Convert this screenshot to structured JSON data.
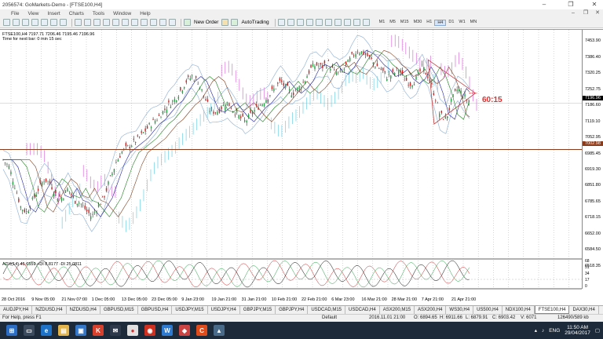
{
  "window": {
    "title": "2056574: GoMarkets-Demo - [FTSE100,H4]"
  },
  "menu": [
    "File",
    "View",
    "Insert",
    "Charts",
    "Tools",
    "Window",
    "Help"
  ],
  "toolbar": {
    "new_order": "New Order",
    "autotrading": "AutoTrading"
  },
  "timeframes": [
    "M1",
    "M5",
    "M15",
    "M30",
    "H1",
    "H4",
    "D1",
    "W1",
    "MN"
  ],
  "active_timeframe": "H4",
  "chart": {
    "info_line1": "FTSE100,H4  7197.71 7206.46 7195.46 7196.96",
    "info_line2": "Time for next bar: 0 min 15 sec",
    "osc_label": "ADX(14) 45.6559 +DI 8.8177 -DI 25.0811",
    "annotation": "60:15",
    "current_price": "7196.96",
    "horizontal_line_price": "7002.98",
    "price_ticks": [
      "7453.90",
      "7386.40",
      "7320.25",
      "7252.75",
      "7186.60",
      "7119.10",
      "7052.95",
      "6985.45",
      "6919.30",
      "6851.80",
      "6785.65",
      "6718.15",
      "6652.00",
      "6584.50",
      "6518.35"
    ],
    "osc_ticks": [
      "68",
      "51",
      "34",
      "17",
      "0"
    ],
    "time_ticks": [
      "28 Oct 2016",
      "9 Nov 05:00",
      "21 Nov 07:00",
      "1 Dec 05:00",
      "13 Dec 05:00",
      "23 Dec 05:00",
      "9 Jan 23:00",
      "19 Jan 21:00",
      "31 Jan 21:00",
      "10 Feb 21:00",
      "22 Feb 21:00",
      "6 Mar 23:00",
      "16 Mar 21:00",
      "28 Mar 21:00",
      "7 Apr 21:00",
      "21 Apr 21:00"
    ]
  },
  "chart_data": {
    "type": "candlestick",
    "symbol": "FTSE100",
    "timeframe": "H4",
    "ylim": [
      6500,
      7480
    ],
    "close_path": [
      [
        0,
        6960
      ],
      [
        1,
        6930
      ],
      [
        2,
        6850
      ],
      [
        3,
        6760
      ],
      [
        4,
        6740
      ],
      [
        5,
        6790
      ],
      [
        6,
        6840
      ],
      [
        7,
        6880
      ],
      [
        8,
        6860
      ],
      [
        9,
        6810
      ],
      [
        10,
        6800
      ],
      [
        11,
        6840
      ],
      [
        12,
        6790
      ],
      [
        13,
        6780
      ],
      [
        14,
        6750
      ],
      [
        15,
        6720
      ],
      [
        16,
        6760
      ],
      [
        17,
        6800
      ],
      [
        18,
        6870
      ],
      [
        19,
        6940
      ],
      [
        20,
        6990
      ],
      [
        21,
        7010
      ],
      [
        22,
        7030
      ],
      [
        23,
        7050
      ],
      [
        24,
        7080
      ],
      [
        25,
        7110
      ],
      [
        26,
        7130
      ],
      [
        27,
        7160
      ],
      [
        28,
        7190
      ],
      [
        29,
        7210
      ],
      [
        30,
        7250
      ],
      [
        31,
        7290
      ],
      [
        32,
        7310
      ],
      [
        33,
        7290
      ],
      [
        34,
        7230
      ],
      [
        35,
        7170
      ],
      [
        36,
        7160
      ],
      [
        37,
        7180
      ],
      [
        38,
        7200
      ],
      [
        39,
        7170
      ],
      [
        40,
        7140
      ],
      [
        41,
        7120
      ],
      [
        42,
        7150
      ],
      [
        43,
        7180
      ],
      [
        44,
        7200
      ],
      [
        45,
        7230
      ],
      [
        46,
        7260
      ],
      [
        47,
        7290
      ],
      [
        48,
        7260
      ],
      [
        49,
        7240
      ],
      [
        50,
        7260
      ],
      [
        51,
        7290
      ],
      [
        52,
        7340
      ],
      [
        53,
        7360
      ],
      [
        54,
        7350
      ],
      [
        55,
        7370
      ],
      [
        56,
        7330
      ],
      [
        57,
        7320
      ],
      [
        58,
        7350
      ],
      [
        59,
        7390
      ],
      [
        60,
        7420
      ],
      [
        61,
        7410
      ],
      [
        62,
        7390
      ],
      [
        63,
        7360
      ],
      [
        64,
        7340
      ],
      [
        65,
        7310
      ],
      [
        66,
        7320
      ],
      [
        67,
        7340
      ],
      [
        68,
        7300
      ],
      [
        69,
        7280
      ],
      [
        70,
        7300
      ],
      [
        71,
        7350
      ],
      [
        72,
        7310
      ],
      [
        73,
        7240
      ],
      [
        74,
        7150
      ],
      [
        75,
        7130
      ],
      [
        76,
        7210
      ],
      [
        77,
        7260
      ],
      [
        78,
        7230
      ],
      [
        79,
        7197
      ]
    ],
    "horizontal_line": 7003,
    "triangle": [
      [
        72,
        7380
      ],
      [
        80,
        7240
      ],
      [
        73,
        7110
      ]
    ],
    "annotation": "60:15",
    "indicator": {
      "name": "ADX(14)",
      "ylim": [
        0,
        68
      ]
    }
  },
  "tabs": [
    "AUDJPY,H4",
    "NZDUSD,H4",
    "NZDUSD,H4",
    "GBPUSD,M15",
    "GBPUSD,H4",
    "USDJPY,M15",
    "USDJPY,H4",
    "GBPJPY,M15",
    "GBPJPY,H4",
    "USDCAD,M15",
    "USDCAD,H4",
    "ASX200,M15",
    "ASX200,H4",
    "WS30,H4",
    "US500,H4",
    "NDX100,H4",
    "FTSE100,H4",
    "DAX30,H4"
  ],
  "active_tab": "FTSE100,H4",
  "status": {
    "help": "For Help, press F1",
    "profile": "Default",
    "bar": "2016.11.01 21:00",
    "open": "O: 6894.65",
    "high": "H: 6911.66",
    "low": "L: 6879.91",
    "close": "C: 6903.42",
    "volume": "V: 6071",
    "traffic": "126490/589 kb"
  },
  "taskbar": {
    "lang": "ENG",
    "time": "11:50 AM",
    "date": "29/04/2017"
  }
}
